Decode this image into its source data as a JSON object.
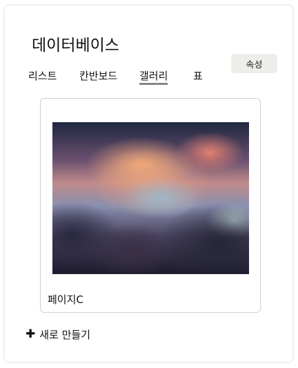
{
  "title": "데이터베이스",
  "properties_button": "속성",
  "tabs": [
    {
      "label": "리스트",
      "active": false
    },
    {
      "label": "칸반보드",
      "active": false
    },
    {
      "label": "갤러리",
      "active": true
    },
    {
      "label": "표",
      "active": false
    }
  ],
  "gallery": {
    "cards": [
      {
        "title": "페이지C"
      }
    ]
  },
  "new_button": {
    "icon": "plus-icon",
    "label": "새로 만들기"
  }
}
